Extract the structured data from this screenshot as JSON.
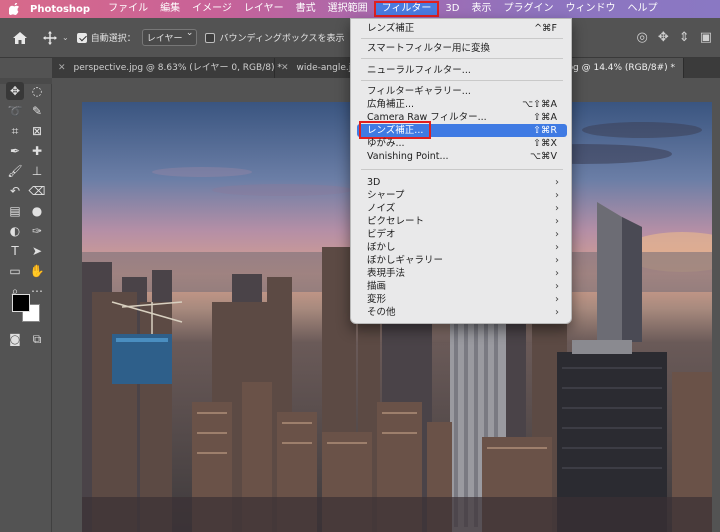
{
  "menubar": {
    "app_name": "Photoshop",
    "menus": [
      "ファイル",
      "編集",
      "イメージ",
      "レイヤー",
      "書式",
      "選択範囲",
      "フィルター",
      "3D",
      "表示",
      "プラグイン",
      "ウィンドウ",
      "ヘルプ"
    ],
    "open_menu": "フィルター"
  },
  "options": {
    "auto_select_label": "自動選択：",
    "auto_select_value": "レイヤー",
    "bounding_box_label": "バウンディングボックスを表示"
  },
  "tabs": [
    {
      "label": "perspective.jpg @ 8.63% (レイヤー 0, RGB/8) *"
    },
    {
      "label": "wide-angle.jpg"
    },
    {
      "label": "n.jpg @ 14.4% (RGB/8#) *"
    }
  ],
  "filter_menu": {
    "items": [
      {
        "label": "レンズ補正",
        "shortcut": "^⌘F"
      },
      {
        "label": "スマートフィルター用に変換",
        "shortcut": ""
      },
      {
        "label": "ニューラルフィルター...",
        "shortcut": ""
      },
      {
        "label": "フィルターギャラリー...",
        "shortcut": ""
      },
      {
        "label": "広角補正...",
        "shortcut": "⌥⇧⌘A"
      },
      {
        "label": "Camera Raw フィルター...",
        "shortcut": "⇧⌘A"
      },
      {
        "label": "レンズ補正...",
        "shortcut": "⇧⌘R"
      },
      {
        "label": "ゆがみ...",
        "shortcut": "⇧⌘X"
      },
      {
        "label": "Vanishing Point...",
        "shortcut": "⌥⌘V"
      }
    ],
    "submenus": [
      "3D",
      "シャープ",
      "ノイズ",
      "ピクセレート",
      "ビデオ",
      "ぼかし",
      "ぼかしギャラリー",
      "表現手法",
      "描画",
      "変形",
      "その他"
    ],
    "highlighted": "レンズ補正..."
  },
  "colors": {
    "menu_highlight": "#3f7ae3",
    "annotation_red": "#e02020"
  }
}
